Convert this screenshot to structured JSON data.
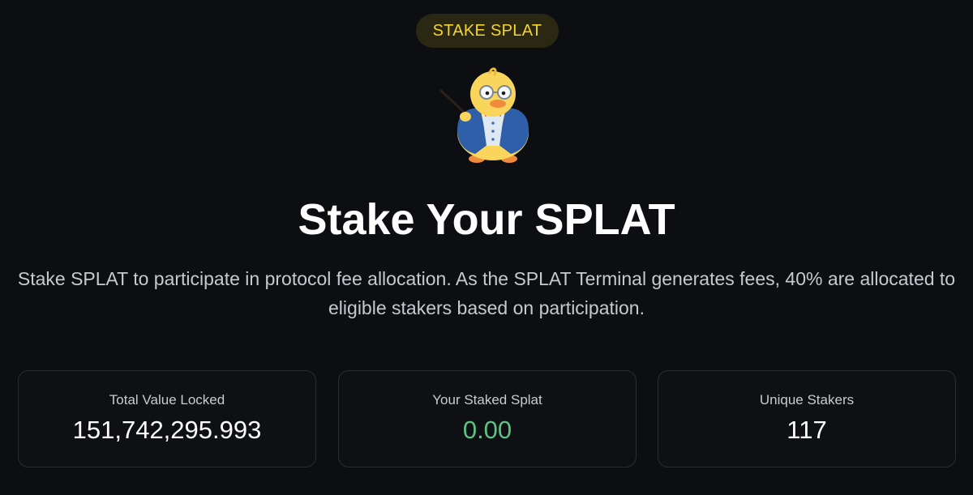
{
  "badge": {
    "label": "STAKE SPLAT"
  },
  "hero": {
    "title": "Stake Your SPLAT",
    "subtitle": "Stake SPLAT to participate in protocol fee allocation. As the SPLAT Terminal generates fees, 40% are allocated to eligible stakers based on participation."
  },
  "mascot": {
    "icon": "duck-professor-mascot-icon"
  },
  "stats": [
    {
      "label": "Total Value Locked",
      "value": "151,742,295.993"
    },
    {
      "label": "Your Staked Splat",
      "value": "0.00",
      "color": "#5ec283"
    },
    {
      "label": "Unique Stakers",
      "value": "117"
    }
  ],
  "colors": {
    "background": "#0d0e12",
    "badge_text": "#f5d432",
    "badge_bg": "#2a2712",
    "positive": "#5ec283"
  }
}
